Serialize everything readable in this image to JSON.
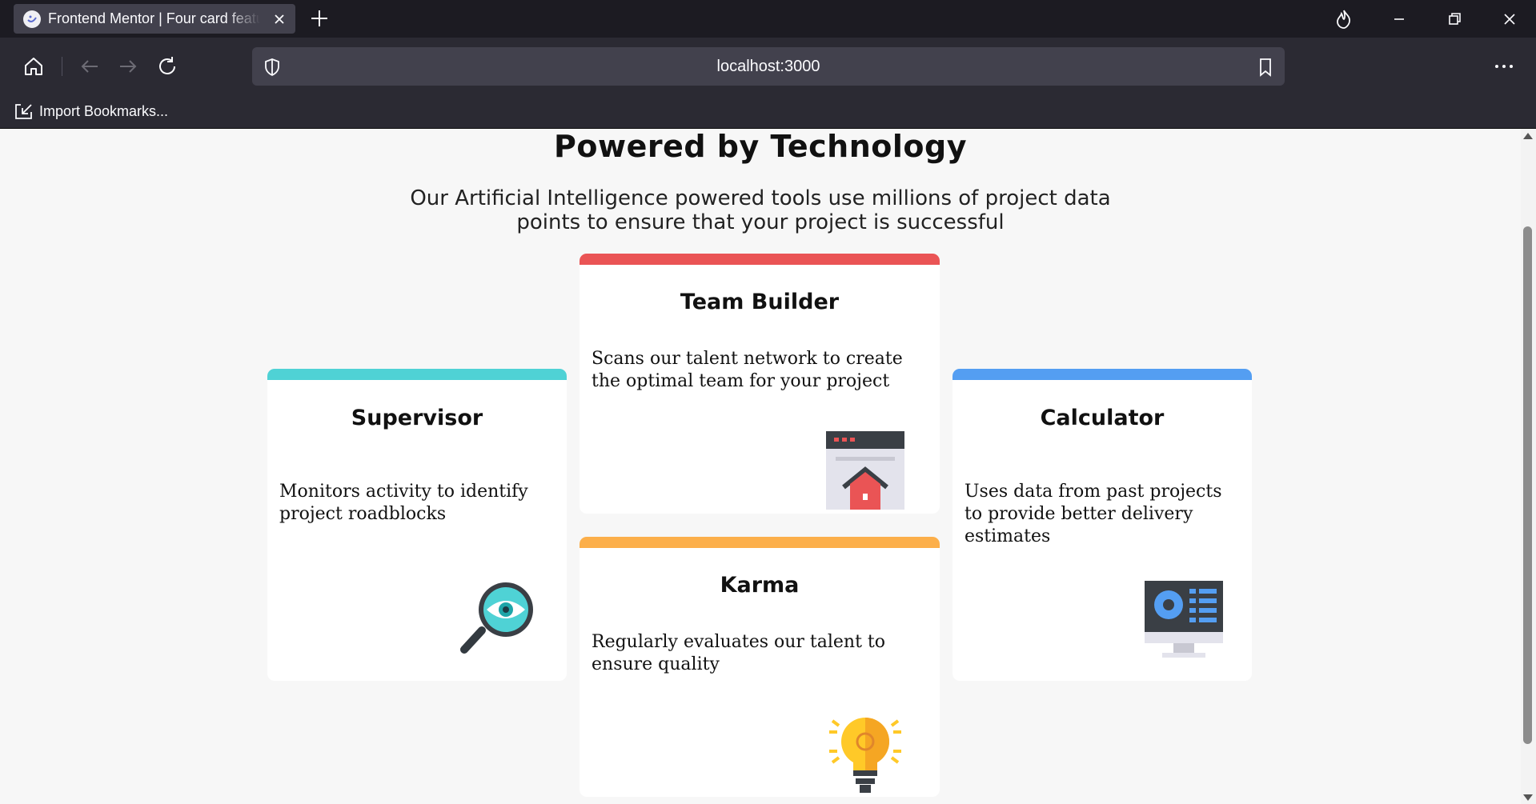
{
  "browser": {
    "tab_title": "Frontend Mentor | Four card feature section",
    "url": "localhost:3000",
    "bookmark_label": "Import Bookmarks..."
  },
  "page": {
    "title": "Powered by Technology",
    "subtitle": "Our Artificial Intelligence powered tools use millions of project data points to ensure that your project is successful"
  },
  "cards": {
    "supervisor": {
      "title": "Supervisor",
      "text": "Monitors activity to identify project roadblocks",
      "accent": "#4fd2d5",
      "icon": "magnifier-eye-icon"
    },
    "team_builder": {
      "title": "Team Builder",
      "text": "Scans our talent network to create the optimal team for your project",
      "accent": "#ea5455",
      "icon": "browser-house-icon"
    },
    "karma": {
      "title": "Karma",
      "text": "Regularly evaluates our talent to ensure quality",
      "accent": "#fcaf4a",
      "icon": "lightbulb-icon"
    },
    "calculator": {
      "title": "Calculator",
      "text": "Uses data from past projects to provide better delivery estimates",
      "accent": "#549ef2",
      "icon": "monitor-chart-icon"
    }
  }
}
